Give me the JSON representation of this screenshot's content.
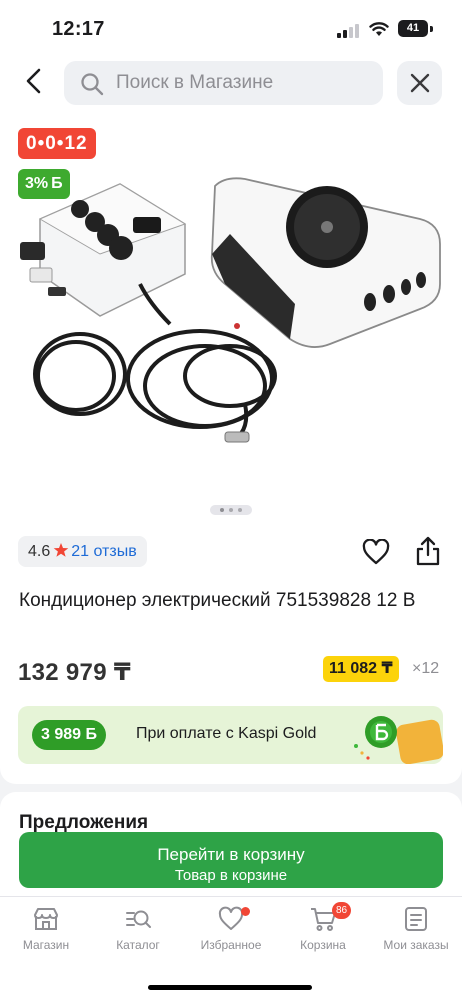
{
  "status_bar": {
    "time": "12:17",
    "battery": "41"
  },
  "search": {
    "placeholder": "Поиск в Магазине"
  },
  "product": {
    "installment_badge": "0•0•12",
    "bonus_badge": "3%",
    "bonus_symbol": "Б",
    "carousel": {
      "total": 3,
      "active": 0
    },
    "rating": "4.6",
    "reviews": "21 отзыв",
    "title": "Кондиционер электрический 751539828 12 В",
    "price": "132 979 ₸",
    "monthly_payment": "11 082 ₸",
    "months": "×12"
  },
  "kaspi_gold": {
    "bonus": "3 989",
    "bonus_symbol": "Б",
    "text": "При оплате с Kaspi Gold"
  },
  "offers": {
    "title": "Предложения"
  },
  "cart_button": {
    "label": "Перейти в корзину",
    "sublabel": "Товар в корзине"
  },
  "tabs": [
    {
      "label": "Магазин",
      "icon": "store-icon"
    },
    {
      "label": "Каталог",
      "icon": "catalog-search-icon"
    },
    {
      "label": "Избранное",
      "icon": "heart-icon",
      "dot": true
    },
    {
      "label": "Корзина",
      "icon": "cart-icon",
      "badge": "86"
    },
    {
      "label": "Мои заказы",
      "icon": "orders-icon"
    }
  ],
  "colors": {
    "brand_red": "#f14635",
    "green": "#2ea347",
    "yellow": "#fcd30a",
    "link": "#1e6bd6"
  }
}
